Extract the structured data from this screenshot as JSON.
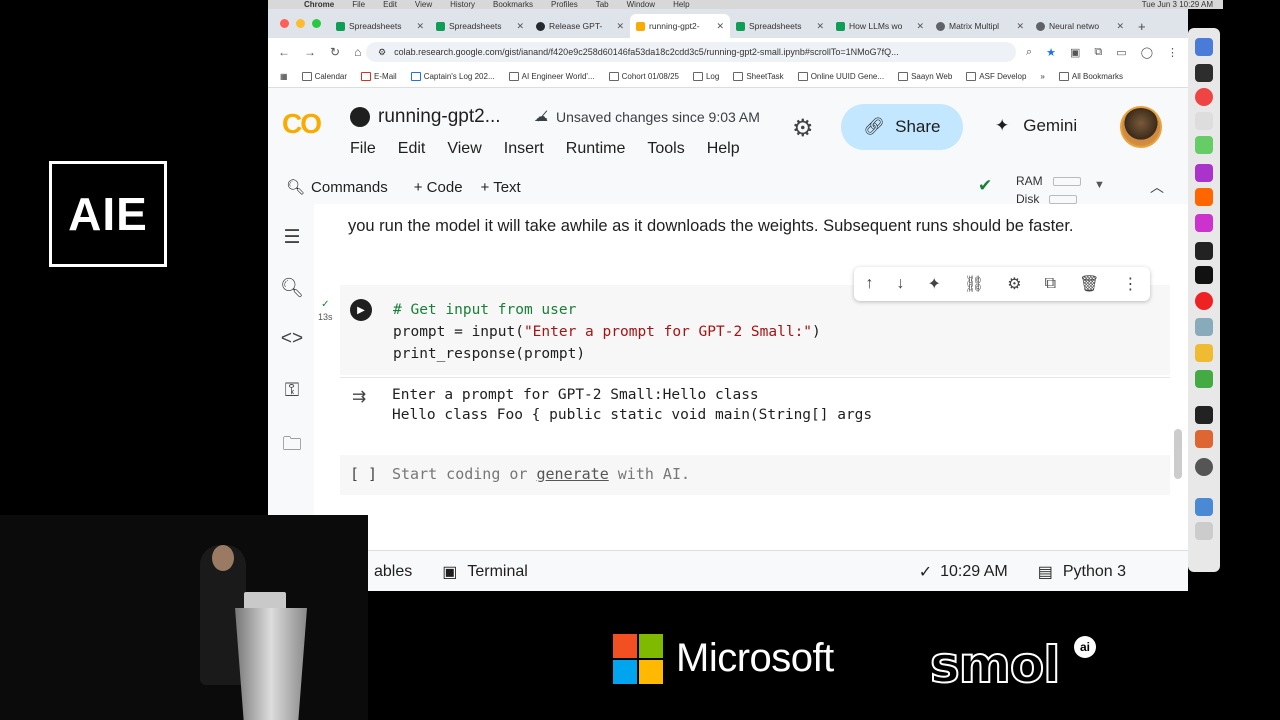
{
  "event_logo": "AIE",
  "menubar": {
    "app": "Chrome",
    "items": [
      "File",
      "Edit",
      "View",
      "History",
      "Bookmarks",
      "Profiles",
      "Tab",
      "Window",
      "Help"
    ],
    "time": "Tue Jun 3  10:29 AM"
  },
  "browser": {
    "tabs": [
      {
        "label": "Spreadsheets",
        "color": "#0f9d58"
      },
      {
        "label": "Spreadsheets",
        "color": "#0f9d58"
      },
      {
        "label": "Release GPT-",
        "color": "#24292f"
      },
      {
        "label": "running-gpt2-",
        "color": "#f9ab00"
      },
      {
        "label": "Spreadsheets",
        "color": "#0f9d58"
      },
      {
        "label": "How LLMs wo",
        "color": "#0f9d58"
      },
      {
        "label": "Matrix Multipl",
        "color": "#5f6368"
      },
      {
        "label": "Neural netwo",
        "color": "#5f6368"
      }
    ],
    "url": "colab.research.google.com/gist/ianand/f420e9c258d60146fa53da18c2cdd3c5/running-gpt2-small.ipynb#scrollTo=1NMoG7fQ...",
    "bookmarks": [
      "Calendar",
      "E-Mail",
      "Captain's Log 202...",
      "AI Engineer World'...",
      "Cohort 01/08/25",
      "Log",
      "SheetTask",
      "Online UUID Gene...",
      "Saayn Web",
      "ASF Develop",
      "All Bookmarks"
    ]
  },
  "colab": {
    "logo": "CO",
    "notebook_title": "running-gpt2...",
    "unsaved": "Unsaved changes since 9:03 AM",
    "menu": [
      "File",
      "Edit",
      "View",
      "Insert",
      "Runtime",
      "Tools",
      "Help"
    ],
    "share_label": "Share",
    "gemini_label": "Gemini",
    "toolbar": {
      "commands": "Commands",
      "code": "+ Code",
      "text": "+ Text"
    },
    "ram_label": "RAM",
    "disk_label": "Disk",
    "markdown_text": "you run the model it will take awhile as it downloads the weights. Subsequent runs should be faster.",
    "cell": {
      "exec_time": "13s",
      "code_comment": "# Get input from user",
      "code_line2_a": "prompt = input(",
      "code_line2_str": "\"Enter a prompt for GPT-2 Small:\"",
      "code_line2_b": ")",
      "code_line3": "print_response(prompt)"
    },
    "output_lines": [
      "Enter a prompt for GPT-2 Small:Hello class",
      "Hello class Foo { public static void main(String[] args"
    ],
    "empty_cell": {
      "bracket": "[ ]",
      "placeholder_a": "Start coding or ",
      "placeholder_link": "generate",
      "placeholder_b": " with AI."
    },
    "status": {
      "variables": "ables",
      "terminal": "Terminal",
      "time": "10:29 AM",
      "runtime": "Python 3"
    }
  },
  "sponsors": {
    "microsoft": "Microsoft",
    "smol": "smol",
    "smol_badge": "ai"
  }
}
